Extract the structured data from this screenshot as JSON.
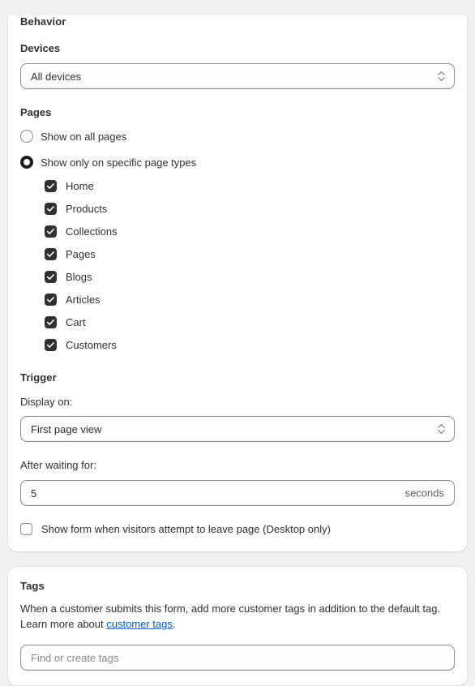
{
  "behavior": {
    "section_title": "Behavior",
    "devices": {
      "label": "Devices",
      "selected": "All devices",
      "chevron_icon": "chevron-updown-icon"
    },
    "pages": {
      "label": "Pages",
      "options": [
        {
          "label": "Show on all pages",
          "selected": false
        },
        {
          "label": "Show only on specific page types",
          "selected": true
        }
      ],
      "page_types": [
        {
          "label": "Home",
          "checked": true
        },
        {
          "label": "Products",
          "checked": true
        },
        {
          "label": "Collections",
          "checked": true
        },
        {
          "label": "Pages",
          "checked": true
        },
        {
          "label": "Blogs",
          "checked": true
        },
        {
          "label": "Articles",
          "checked": true
        },
        {
          "label": "Cart",
          "checked": true
        },
        {
          "label": "Customers",
          "checked": true
        }
      ]
    }
  },
  "trigger": {
    "section_title": "Trigger",
    "display_on": {
      "label": "Display on:",
      "selected": "First page view",
      "chevron_icon": "chevron-updown-icon"
    },
    "after_waiting": {
      "label": "After waiting for:",
      "value": "5",
      "suffix": "seconds"
    },
    "exit_intent": {
      "label": "Show form when visitors attempt to leave page (Desktop only)",
      "checked": false
    }
  },
  "tags": {
    "section_title": "Tags",
    "description_before": "When a customer submits this form, add more customer tags in addition to the default tag. Learn more about ",
    "link_text": "customer tags",
    "description_after": ".",
    "input_placeholder": "Find or create tags"
  },
  "colors": {
    "page_background": "#f1f1f1",
    "card_background": "#ffffff",
    "card_border": "#e3e3e3",
    "text": "#303030",
    "muted_text": "#616161",
    "control_border": "#8a8a8a",
    "checkbox_fill": "#303030",
    "link": "#005bd3"
  }
}
